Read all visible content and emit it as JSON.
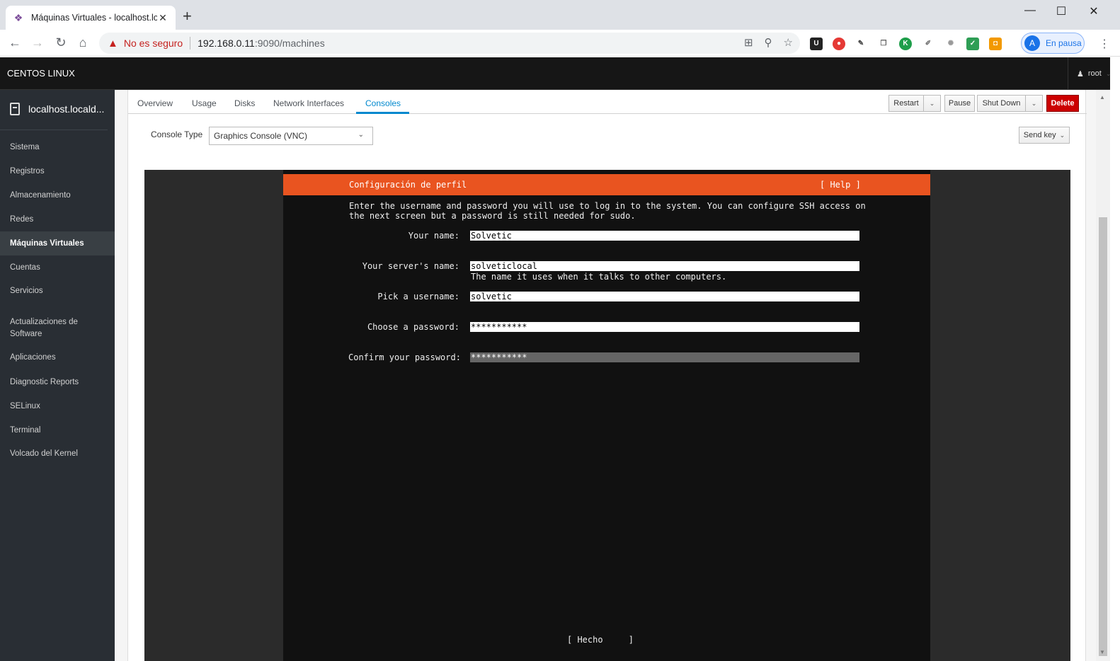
{
  "browser": {
    "tab_title": "Máquinas Virtuales - localhost.lo",
    "new_tab": "+",
    "security_label": "No es seguro",
    "url_host": "192.168.0.11",
    "url_rest": ":9090/machines",
    "profile_initial": "A",
    "profile_label": "En pausa"
  },
  "header": {
    "brand": "CENTOS LINUX",
    "user": "root"
  },
  "sidebar": {
    "host": "localhost.locald...",
    "items": [
      {
        "label": "Sistema"
      },
      {
        "label": "Registros"
      },
      {
        "label": "Almacenamiento"
      },
      {
        "label": "Redes"
      },
      {
        "label": "Máquinas Virtuales"
      },
      {
        "label": "Cuentas"
      },
      {
        "label": "Servicios"
      },
      {
        "label": "Actualizaciones de Software"
      },
      {
        "label": "Aplicaciones"
      },
      {
        "label": "Diagnostic Reports"
      },
      {
        "label": "SELinux"
      },
      {
        "label": "Terminal"
      },
      {
        "label": "Volcado del Kernel"
      }
    ],
    "active_item": "Máquinas Virtuales"
  },
  "vm_tabs": [
    "Overview",
    "Usage",
    "Disks",
    "Network Interfaces",
    "Consoles"
  ],
  "active_tab": "Consoles",
  "actions": {
    "restart": "Restart",
    "pause": "Pause",
    "shutdown": "Shut Down",
    "delete": "Delete",
    "send_key": "Send key"
  },
  "console": {
    "type_label": "Console Type",
    "type_value": "Graphics Console (VNC)"
  },
  "installer": {
    "title": "Configuración de perfil",
    "help": "[ Help ]",
    "intro_line1": "Enter the username and password you will use to log in to the system. You can configure SSH access on",
    "intro_line2": "the next screen but a password is still needed for sudo.",
    "fields": [
      {
        "label": "Your name:",
        "value": "Solvetic"
      },
      {
        "label": "Your server's name:",
        "value": "solveticlocal",
        "hint": "The name it uses when it talks to other computers."
      },
      {
        "label": "Pick a username:",
        "value": "solvetic"
      },
      {
        "label": "Choose a password:",
        "value": "***********"
      },
      {
        "label": "Confirm your password:",
        "value": "***********"
      }
    ],
    "done_button": "[ Hecho     ]"
  },
  "colors": {
    "installer_accent": "#e95420",
    "delete_button": "#cc0000",
    "active_tab": "#0088ce"
  }
}
